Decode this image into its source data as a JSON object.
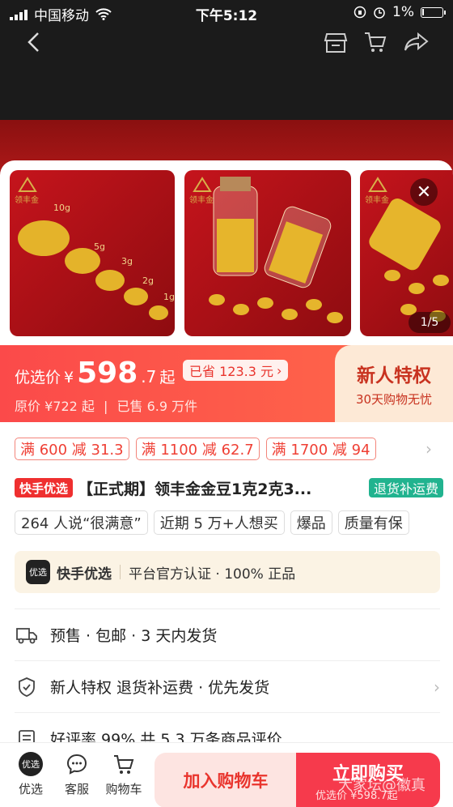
{
  "status": {
    "carrier": "中国移动",
    "time": "下午5:12",
    "battery": "1%"
  },
  "gallery": {
    "thumbs": [
      {
        "logo": "领丰金",
        "weights": [
          "10g",
          "5g",
          "3g",
          "2g",
          "1g"
        ]
      },
      {
        "logo": "领丰金"
      },
      {
        "logo": "领丰金"
      }
    ],
    "index": "1/5"
  },
  "price": {
    "label": "优选价",
    "currency": "¥",
    "integer": "598",
    "decimal": ".7",
    "suffix": "起",
    "saved": "已省 123.3 元",
    "original": "原价 ¥722 起",
    "sold": "已售 6.9 万件"
  },
  "perk": {
    "title": "新人特权",
    "subtitle": "30天购物无忧"
  },
  "coupons": [
    "满 600 减 31.3",
    "满 1100 减 62.7",
    "满 1700 减 94"
  ],
  "product": {
    "brand_tag": "快手优选",
    "title": "【正式期】领丰金金豆1克2克3...",
    "refund_tag": "退货补运费"
  },
  "tags": [
    "264 人说“很满意”",
    "近期 5 万+人想买",
    "爆品",
    "质量有保"
  ],
  "official": {
    "icon_text": "优选",
    "name": "快手优选",
    "cert": "平台官方认证 · 100% 正品"
  },
  "info_rows": [
    {
      "text": "预售 · 包邮 · 3 天内发货"
    },
    {
      "text": "新人特权 退货补运费 · 优先发货"
    },
    {
      "text": "好评率 99% 共 5.3 万条商品评价"
    }
  ],
  "bottom": {
    "nav": [
      {
        "icon_text": "优选",
        "label": "优选"
      },
      {
        "label": "客服"
      },
      {
        "label": "购物车"
      }
    ],
    "add_cart": "加入购物车",
    "buy_now": "立即购买",
    "buy_sub": "优选价 ¥598.7起"
  },
  "watermark": "大家坛@徽真"
}
